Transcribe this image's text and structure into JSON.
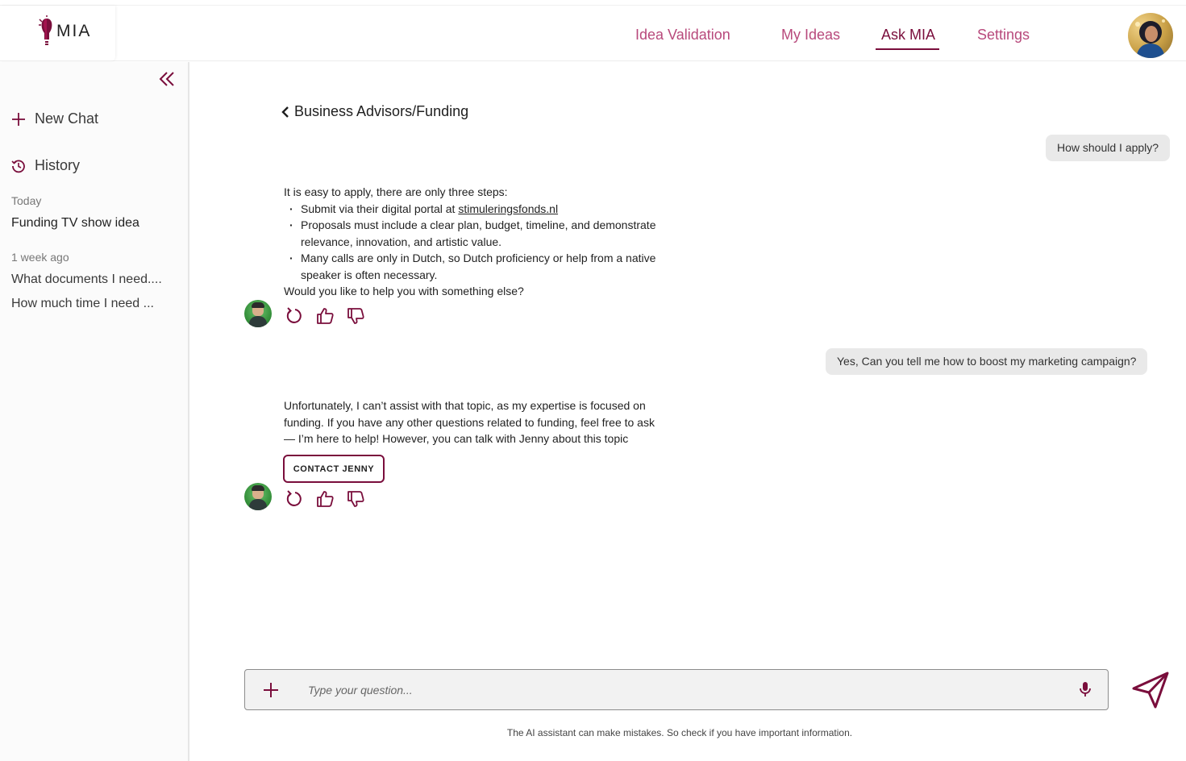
{
  "brand": {
    "name": "MIA",
    "accent": "#7a0e3c",
    "accent_light": "#b84a7c"
  },
  "nav": {
    "items": [
      {
        "label": "Idea Validation",
        "active": false
      },
      {
        "label": "My Ideas",
        "active": false
      },
      {
        "label": "Ask MIA",
        "active": true
      },
      {
        "label": "Settings",
        "active": false
      }
    ]
  },
  "sidebar": {
    "new_chat_label": "New Chat",
    "history_label": "History",
    "groups": [
      {
        "title": "Today",
        "chats": [
          "Funding TV show idea"
        ]
      },
      {
        "title": "1 week ago",
        "chats": [
          "What documents I need....",
          "How much time I need ..."
        ]
      }
    ]
  },
  "conversation": {
    "back_label": "Business Advisors/Funding",
    "messages": [
      {
        "role": "user",
        "text": "How should I apply?"
      },
      {
        "role": "assistant",
        "intro": "It is easy to apply, there are only three steps:",
        "bullets": [
          {
            "prefix": "Submit via their digital portal at ",
            "link": "stimuleringsfonds.nl"
          },
          {
            "text_line1": "Proposals must include a clear plan, budget, timeline, and demonstrate",
            "text_line2": "relevance, innovation, and artistic value."
          },
          {
            "text_line1": "Many calls are only in Dutch, so Dutch proficiency or help from a native",
            "text_line2": "speaker is often necessary."
          }
        ],
        "outro": "Would you like to help you with something else?"
      },
      {
        "role": "user",
        "text": "Yes, Can you tell me how to boost my marketing campaign?"
      },
      {
        "role": "assistant",
        "lines": [
          "Unfortunately, I can’t assist with that topic, as my expertise is focused on",
          "funding. If you have any other questions related to funding, feel free to ask",
          "— I’m here to help! However, you can talk with Jenny about this topic"
        ],
        "button_label": "CONTACT JENNY"
      }
    ],
    "action_icons": [
      "regenerate-icon",
      "thumbs-up-icon",
      "thumbs-down-icon"
    ]
  },
  "composer": {
    "placeholder": "Type your question...",
    "disclaimer": "The AI assistant can make mistakes. So check if you have important information."
  }
}
